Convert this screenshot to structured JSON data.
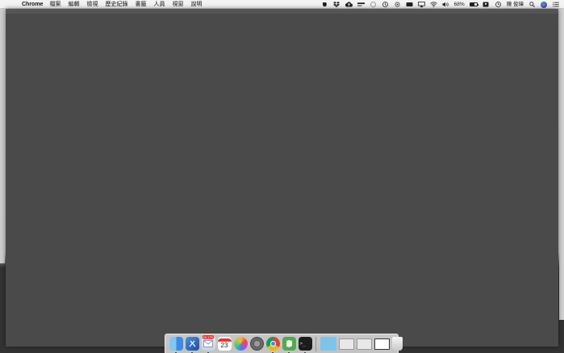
{
  "menubar": {
    "apple_glyph": "",
    "app_name": "Chrome",
    "items": [
      "檔案",
      "編輯",
      "檢視",
      "歷史紀錄",
      "書籤",
      "人員",
      "視窗",
      "說明"
    ],
    "status": {
      "battery_text": "68%",
      "battery_level": 0.68,
      "user_name": "陳 俊瑋"
    }
  },
  "dock": {
    "apps": [
      {
        "name": "Finder",
        "icon": "finder-icon",
        "running": true
      },
      {
        "name": "Xcode",
        "icon": "xcode-icon",
        "running": true
      },
      {
        "name": "Mail",
        "icon": "mail-icon",
        "running": true,
        "badge": "20,175"
      },
      {
        "name": "Calendar",
        "icon": "calendar-icon",
        "running": false,
        "label": "23"
      },
      {
        "name": "Photos",
        "icon": "photos-icon",
        "running": false
      },
      {
        "name": "System Preferences",
        "icon": "settings-icon",
        "running": false
      },
      {
        "name": "Chrome",
        "icon": "chrome-icon",
        "running": true
      },
      {
        "name": "Evernote",
        "icon": "evernote-icon",
        "running": true
      },
      {
        "name": "Terminal",
        "icon": "terminal-icon",
        "running": true,
        "label": ">_"
      }
    ]
  },
  "colors": {
    "window_bg": "#4a4a4a",
    "menubar_bg": "#f3f3f3"
  }
}
